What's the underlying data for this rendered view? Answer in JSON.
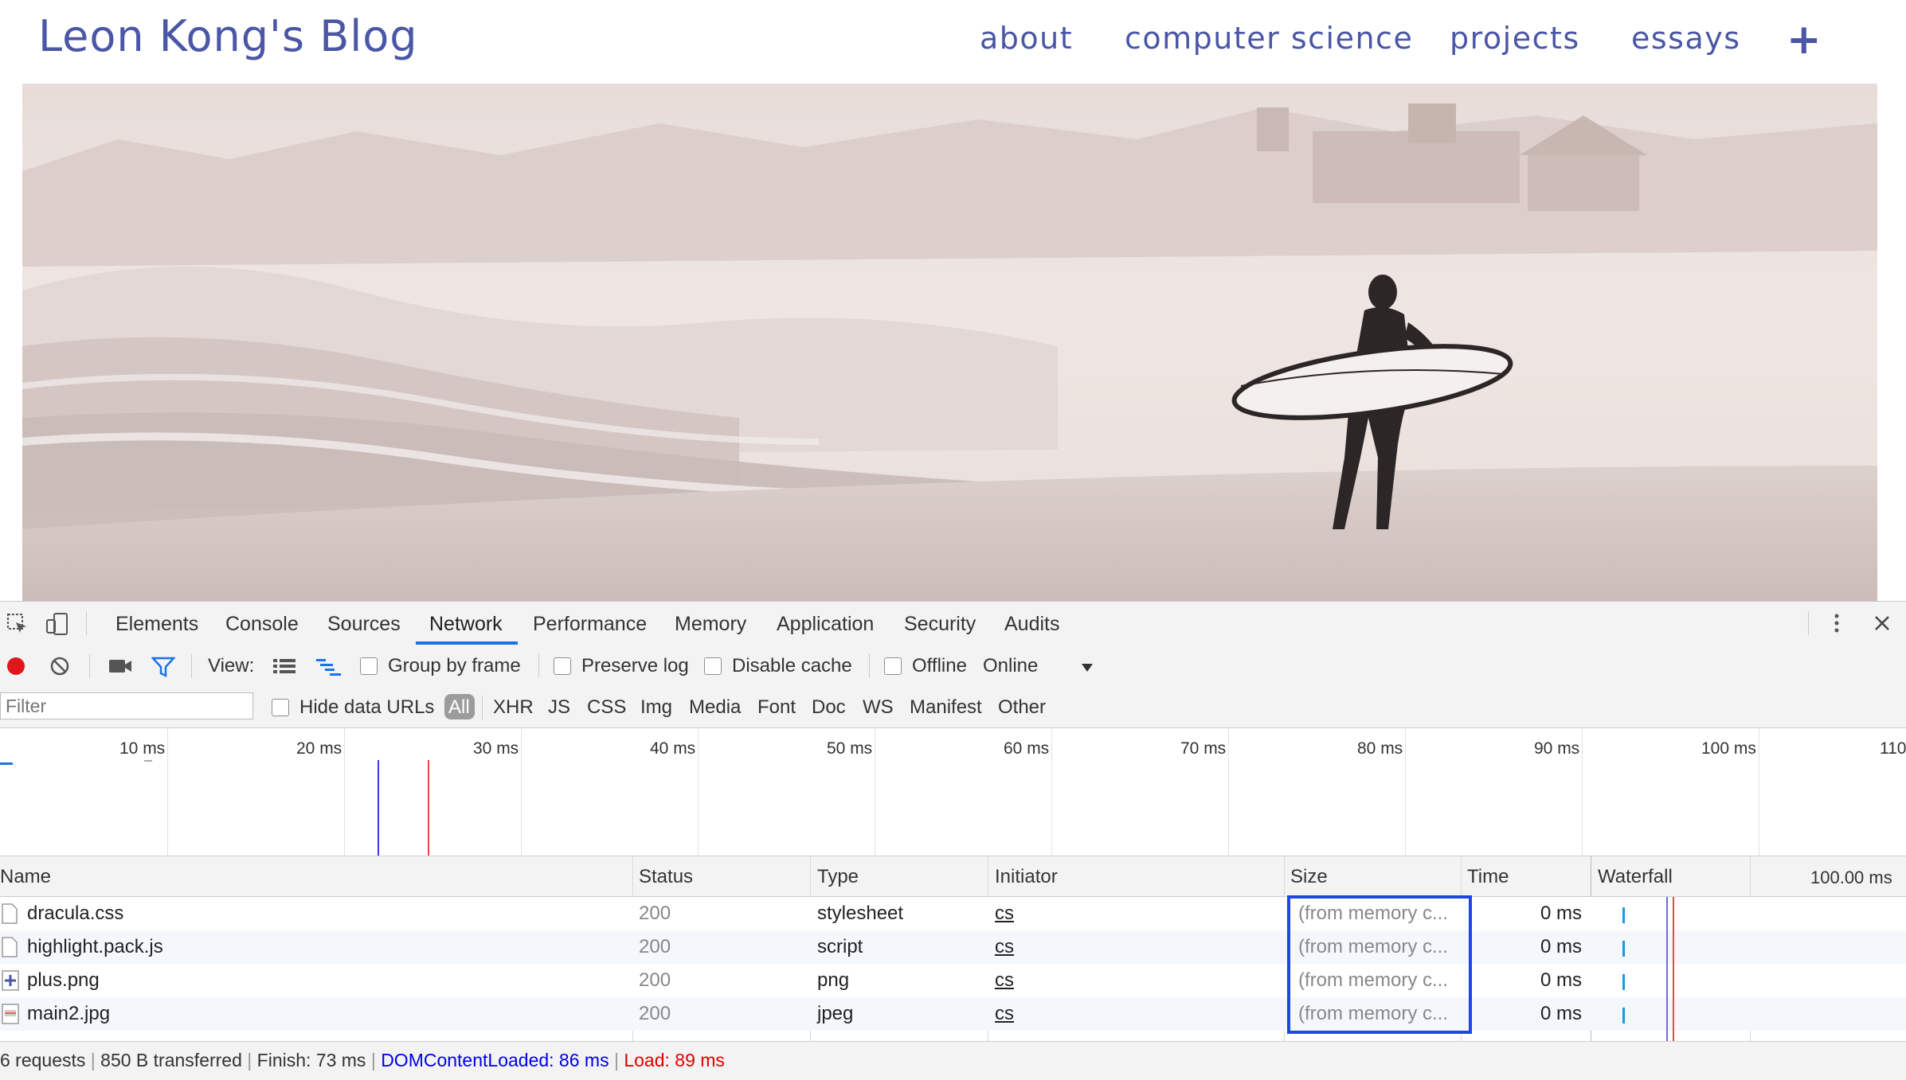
{
  "blog": {
    "title": "Leon Kong's Blog",
    "nav": [
      "about",
      "computer science",
      "projects",
      "essays"
    ],
    "plus": "+"
  },
  "devtools": {
    "tabs": [
      "Elements",
      "Console",
      "Sources",
      "Network",
      "Performance",
      "Memory",
      "Application",
      "Security",
      "Audits"
    ],
    "active_tab": "Network",
    "toolbar": {
      "view_label": "View:",
      "group_by_frame": "Group by frame",
      "preserve_log": "Preserve log",
      "disable_cache": "Disable cache",
      "offline": "Offline",
      "throttle": "Online"
    },
    "filter_bar": {
      "placeholder": "Filter",
      "hide_data_urls": "Hide data URLs",
      "types": [
        "All",
        "XHR",
        "JS",
        "CSS",
        "Img",
        "Media",
        "Font",
        "Doc",
        "WS",
        "Manifest",
        "Other"
      ],
      "active_type": "All"
    },
    "timeline": {
      "ticks": [
        "10 ms",
        "20 ms",
        "30 ms",
        "40 ms",
        "50 ms",
        "60 ms",
        "70 ms",
        "80 ms",
        "90 ms",
        "100 ms",
        "110"
      ]
    },
    "table": {
      "headers": [
        "Name",
        "Status",
        "Type",
        "Initiator",
        "Size",
        "Time",
        "Waterfall"
      ],
      "waterfall_scale": "100.00 ms",
      "rows": [
        {
          "name": "dracula.css",
          "status": "200",
          "type": "stylesheet",
          "initiator": "cs",
          "size": "(from memory c...",
          "time": "0 ms"
        },
        {
          "name": "highlight.pack.js",
          "status": "200",
          "type": "script",
          "initiator": "cs",
          "size": "(from memory c...",
          "time": "0 ms"
        },
        {
          "name": "plus.png",
          "status": "200",
          "type": "png",
          "initiator": "cs",
          "size": "(from memory c...",
          "time": "0 ms"
        },
        {
          "name": "main2.jpg",
          "status": "200",
          "type": "jpeg",
          "initiator": "cs",
          "size": "(from memory c...",
          "time": "0 ms"
        }
      ]
    },
    "status_bar": {
      "requests": "6 requests",
      "transferred": "850 B transferred",
      "finish": "Finish: 73 ms",
      "dom_content_loaded": "DOMContentLoaded: 86 ms",
      "load": "Load: 89 ms"
    },
    "colors": {
      "accent": "#1a73e8",
      "dom_content_loaded": "#0000ee",
      "load": "#e00000",
      "highlight_box": "#1e45e6",
      "record": "#e0161d"
    }
  }
}
